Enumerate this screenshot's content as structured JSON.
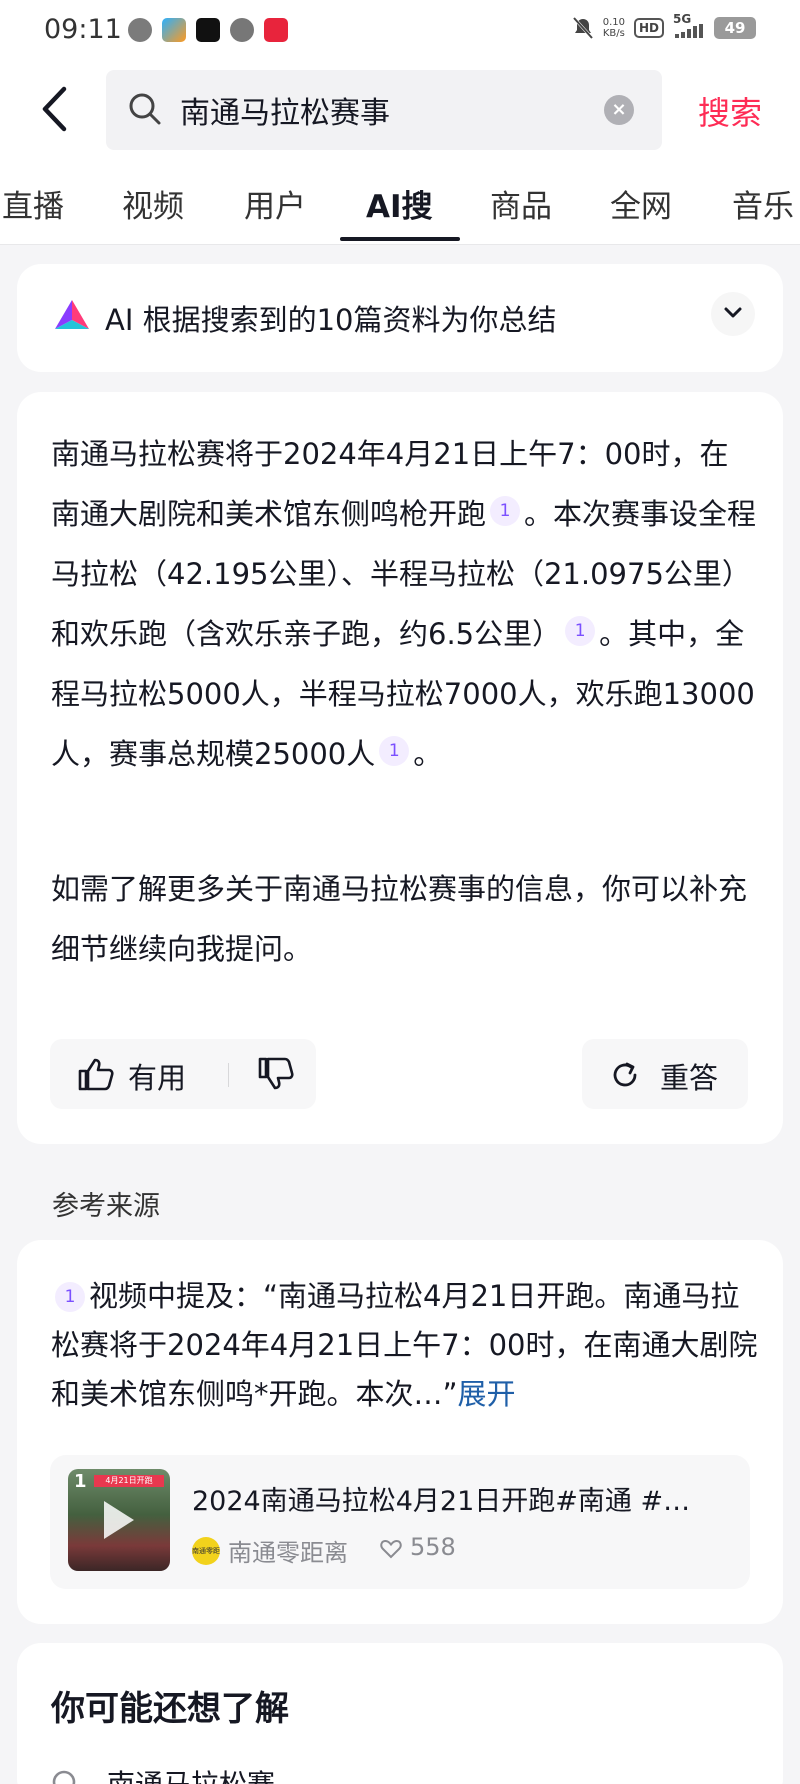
{
  "status_bar": {
    "time": "09:11",
    "network_speed": "0.10",
    "network_unit": "KB/s",
    "hd": "HD",
    "signal": "5G",
    "battery": "49"
  },
  "search": {
    "query": "南通马拉松赛事",
    "submit_label": "搜索"
  },
  "tabs": [
    "直播",
    "视频",
    "用户",
    "AI搜",
    "商品",
    "全网",
    "音乐"
  ],
  "active_tab": "AI搜",
  "ai_summary": {
    "header": "AI 根据搜索到的10篇资料为你总结",
    "para1_a": "南通马拉松赛将于2024年4月21日上午7：00时，在南通大剧院和美术馆东侧鸣枪开跑",
    "cite1": "1",
    "para1_b": "。本次赛事设全程马拉松（42.195公里）、半程马拉松（21.0975公里）和欢乐跑（含欢乐亲子跑，约6.5公里）",
    "cite2": "1",
    "para1_c": "。其中，全程马拉松5000人，半程马拉松7000人，欢乐跑13000人，赛事总规模25000人",
    "cite3": "1",
    "para1_d": "。",
    "para2": "如需了解更多关于南通马拉松赛事的信息，你可以补充细节继续向我提问。",
    "useful_label": "有用",
    "regenerate_label": "重答"
  },
  "references": {
    "title": "参考来源",
    "cite": "1",
    "text": "视频中提及：“南通马拉松4月21日开跑。南通马拉松赛将于2024年4月21日上午7：00时，在南通大剧院和美术馆东侧鸣*开跑。本次…”",
    "expand_label": "展开",
    "video": {
      "index": "1",
      "banner": "4月21日开跑",
      "title": "2024南通马拉松4月21日开跑#南通 #…",
      "author": "南通零距离",
      "avatar_text": "南通零距离",
      "likes": "558"
    }
  },
  "related": {
    "title": "你可能还想了解",
    "items": [
      "南通马拉松赛"
    ]
  },
  "colors": {
    "accent": "#fe2c55",
    "link": "#1f5fa8",
    "cite_text": "#7b50ff",
    "cite_bg": "#f3edff"
  }
}
